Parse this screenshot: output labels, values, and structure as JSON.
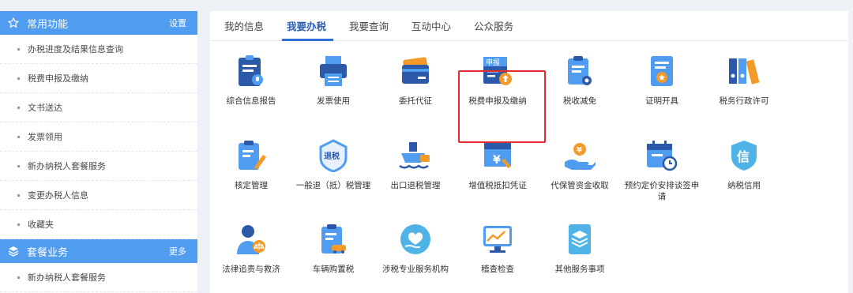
{
  "sidebar": {
    "common": {
      "title": "常用功能",
      "action": "设置",
      "items": [
        "办税进度及结果信息查询",
        "税费申报及缴纳",
        "文书送达",
        "发票领用",
        "新办纳税人套餐服务",
        "变更办税人信息",
        "收藏夹"
      ]
    },
    "package": {
      "title": "套餐业务",
      "action": "更多",
      "items": [
        "新办纳税人套餐服务"
      ]
    }
  },
  "tabs": [
    "我的信息",
    "我要办税",
    "我要查询",
    "互动中心",
    "公众服务"
  ],
  "active_tab": "我要办税",
  "services": [
    {
      "label": "综合信息报告",
      "icon": "info-report-icon"
    },
    {
      "label": "发票使用",
      "icon": "invoice-printer-icon"
    },
    {
      "label": "委托代征",
      "icon": "card-icon"
    },
    {
      "label": "税费申报及缴纳",
      "icon": "declare-upload-icon",
      "badge": "申报"
    },
    {
      "label": "税收减免",
      "icon": "tax-reduction-icon"
    },
    {
      "label": "证明开具",
      "icon": "certificate-icon"
    },
    {
      "label": "税务行政许可",
      "icon": "binders-icon"
    },
    {
      "label": "核定管理",
      "icon": "clipboard-pen-icon"
    },
    {
      "label": "一般退（抵）税管理",
      "icon": "refund-shield-icon",
      "badge": "退税"
    },
    {
      "label": "出口退税管理",
      "icon": "ship-icon"
    },
    {
      "label": "增值税抵扣凭证",
      "icon": "yuan-ticket-icon"
    },
    {
      "label": "代保管资金收取",
      "icon": "hand-coin-icon"
    },
    {
      "label": "预约定价安排谈签申请",
      "icon": "calendar-clock-icon"
    },
    {
      "label": "纳税信用",
      "icon": "credit-shield-icon",
      "badge": "信"
    },
    {
      "label": "法律追责与救济",
      "icon": "law-person-icon"
    },
    {
      "label": "车辆购置税",
      "icon": "car-doc-icon"
    },
    {
      "label": "涉税专业服务机构",
      "icon": "heart-hand-icon"
    },
    {
      "label": "稽查检查",
      "icon": "chart-monitor-icon"
    },
    {
      "label": "其他服务事项",
      "icon": "layers-doc-icon"
    }
  ],
  "colors": {
    "blue": "#4f9cf0",
    "navy": "#2c5aa8",
    "orange": "#f49a2a",
    "highlight": "#e02d2d"
  }
}
